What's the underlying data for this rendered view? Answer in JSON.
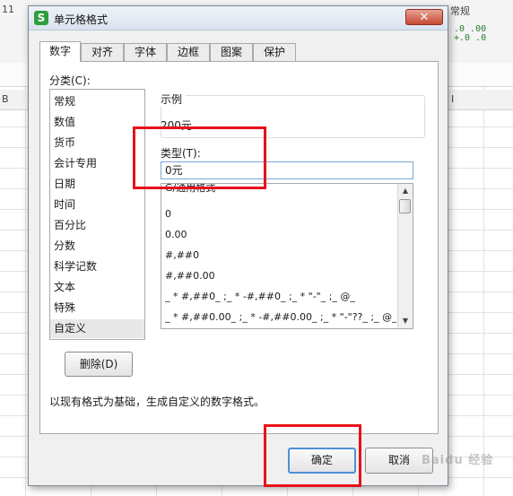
{
  "background": {
    "col_letter_b": "B",
    "col_letter_i": "I",
    "ribbon_top_right": "常规",
    "row_number": "11",
    "right_icons": [
      ".0 .00",
      "←.0 →.0",
      "+.0 .0"
    ]
  },
  "dialog": {
    "title": "单元格格式",
    "app_icon_letter": "S",
    "close_glyph": "✕",
    "tabs": [
      {
        "label": "数字",
        "active": true
      },
      {
        "label": "对齐"
      },
      {
        "label": "字体"
      },
      {
        "label": "边框"
      },
      {
        "label": "图案"
      },
      {
        "label": "保护"
      }
    ],
    "category_label": "分类(C):",
    "categories": [
      "常规",
      "数值",
      "货币",
      "会计专用",
      "日期",
      "时间",
      "百分比",
      "分数",
      "科学记数",
      "文本",
      "特殊",
      "自定义"
    ],
    "selected_category": "自定义",
    "sample_label": "示例",
    "sample_value": "200元",
    "type_label": "类型(T):",
    "type_value": "0元",
    "formats": [
      "G/通用格式",
      "0",
      "0.00",
      "#,##0",
      "#,##0.00",
      "_ * #,##0_ ;_ * -#,##0_ ;_ * \"-\"_ ;_ @_",
      "_ * #,##0.00_ ;_ * -#,##0.00_ ;_ * \"-\"??_ ;_ @_"
    ],
    "delete_label": "删除(D)",
    "description": "以现有格式为基础，生成自定义的数字格式。",
    "ok_label": "确定",
    "cancel_label": "取消"
  },
  "watermark": "Baidu 经验",
  "colors": {
    "highlight": "#e8101a",
    "ok_border": "#4d90d6",
    "app_icon": "#2e9e3c",
    "close": "#c84a32"
  }
}
